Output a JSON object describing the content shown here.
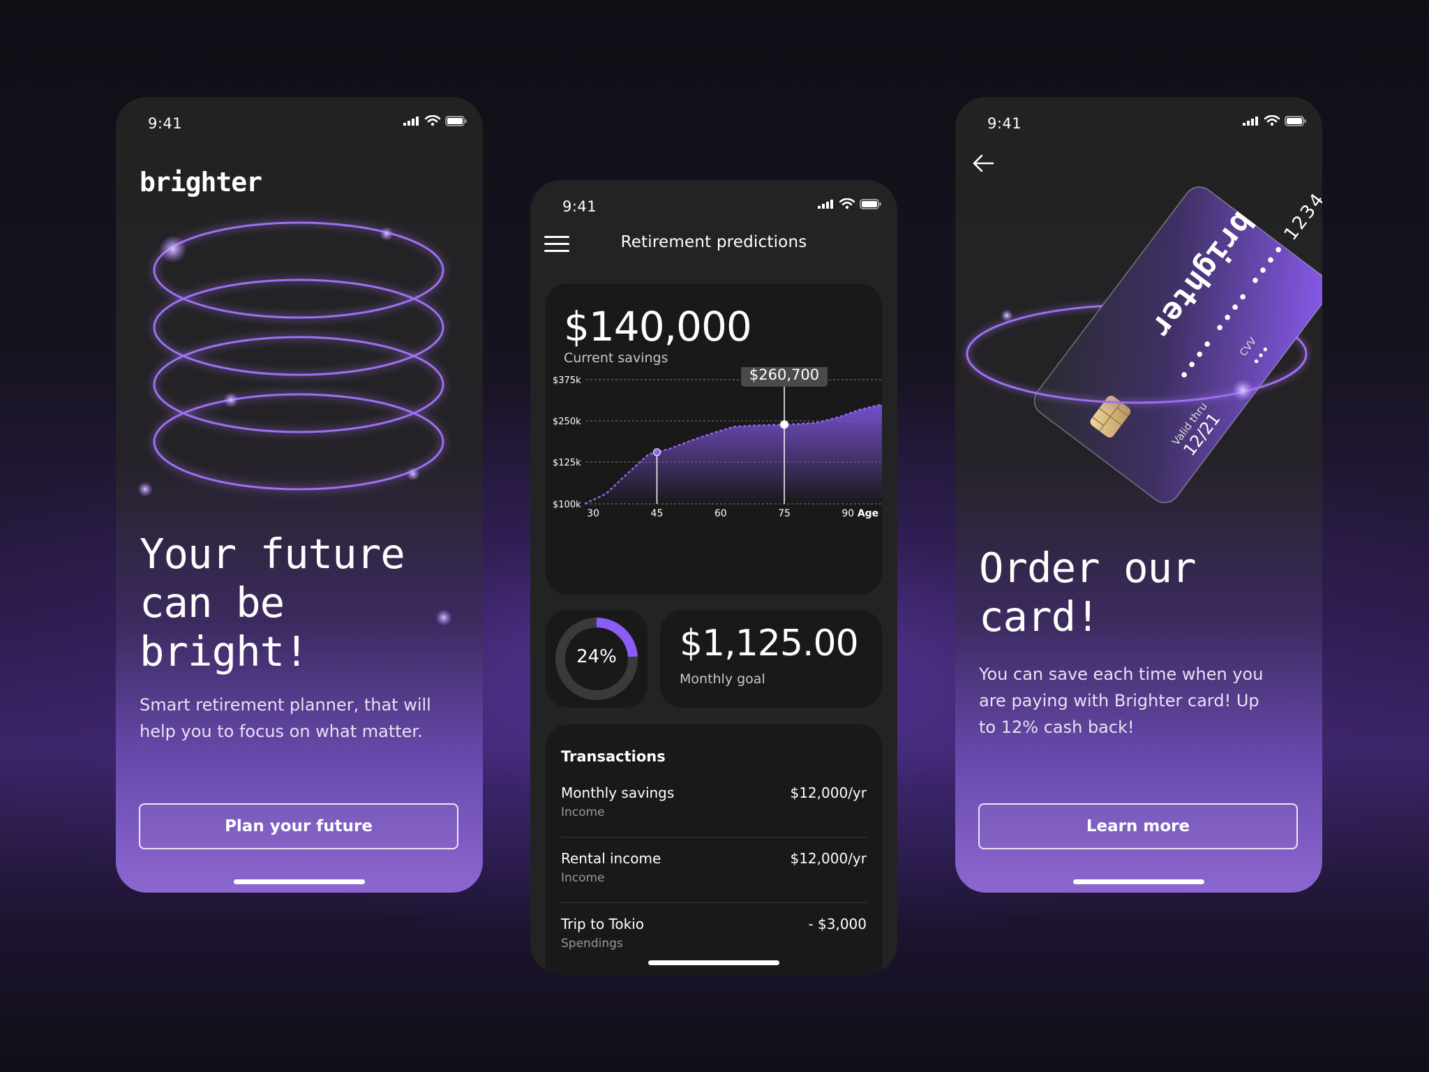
{
  "status": {
    "time": "9:41"
  },
  "welcome": {
    "logo": "brighter",
    "title": "Your future can be bright!",
    "subtitle": "Smart retirement planner, that will help you to focus on what matter.",
    "cta": "Plan your future"
  },
  "predictions": {
    "header_title": "Retirement predictions",
    "current_savings": {
      "amount": "$140,000",
      "label": "Current savings"
    },
    "tooltip": "$260,700",
    "progress_percent_label": "24%",
    "progress_value": 0.24,
    "monthly_goal": {
      "amount": "$1,125.00",
      "label": "Monthly goal"
    },
    "transactions_title": "Transactions",
    "transactions": [
      {
        "name": "Monthly savings",
        "category": "Income",
        "amount": "$12,000/yr"
      },
      {
        "name": "Rental income",
        "category": "Income",
        "amount": "$12,000/yr"
      },
      {
        "name": "Trip to Tokio",
        "category": "Spendings",
        "amount": "- $3,000"
      }
    ]
  },
  "chart_data": {
    "type": "area",
    "x": [
      28,
      33,
      38,
      43,
      48,
      53,
      58,
      63,
      68,
      73,
      78,
      83,
      88,
      93,
      98
    ],
    "y": [
      100,
      106,
      118,
      148,
      165,
      190,
      212,
      232,
      236,
      238,
      240,
      245,
      262,
      285,
      300
    ],
    "x_ticks": [
      "30",
      "45",
      "60",
      "75",
      "90"
    ],
    "x_tick_values": [
      30,
      45,
      60,
      75,
      90
    ],
    "xlabel": "Age",
    "y_ticks": [
      "$375k",
      "$250k",
      "$125k",
      "$100k"
    ],
    "ylim": [
      100,
      375
    ],
    "highlight": {
      "x": 75,
      "label": "$260,700"
    },
    "marker": {
      "x": 45
    },
    "grid": true,
    "colors": {
      "area": "#7b52d6",
      "line": "#8f67e6"
    }
  },
  "card": {
    "title": "Order our card!",
    "subtitle": "You can save each time when you are paying with Brighter card! Up to 12% cash back!",
    "cta": "Learn more",
    "card_brand": "brighter",
    "card_number_masked": "•••• •••• •••• 1234",
    "cvv_label": "CVV",
    "cvv_dots": "•••",
    "valid_label": "Valid thru",
    "valid_date": "12/21"
  },
  "colors": {
    "accent": "#8b5cf6",
    "card_bg": "#191919",
    "phone_bg": "#232323"
  }
}
